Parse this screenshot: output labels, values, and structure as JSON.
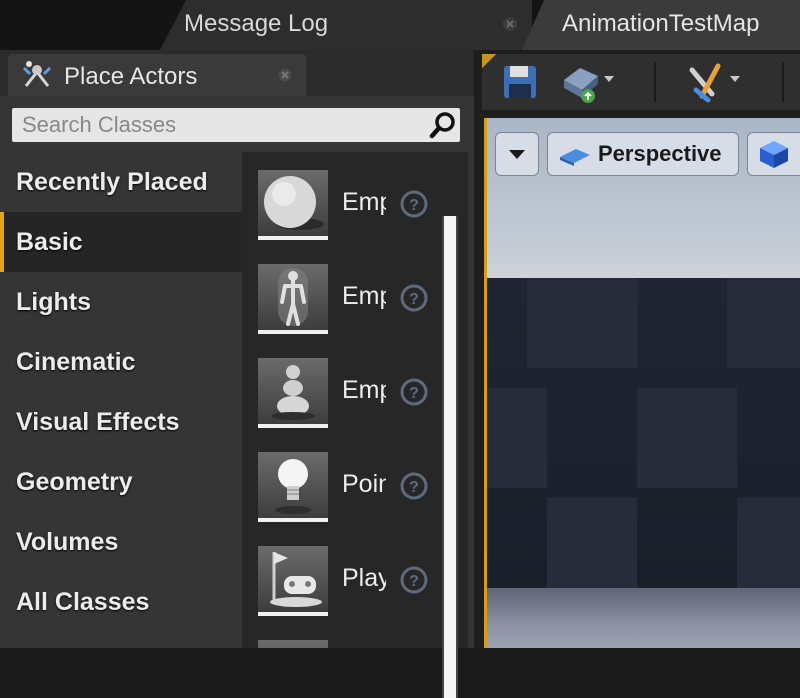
{
  "tabs": {
    "message_log": "Message Log",
    "map": "AnimationTestMap"
  },
  "place_actors": {
    "title": "Place Actors",
    "search_placeholder": "Search Classes",
    "categories": [
      {
        "label": "Recently Placed",
        "active": false
      },
      {
        "label": "Basic",
        "active": true
      },
      {
        "label": "Lights",
        "active": false
      },
      {
        "label": "Cinematic",
        "active": false
      },
      {
        "label": "Visual Effects",
        "active": false
      },
      {
        "label": "Geometry",
        "active": false
      },
      {
        "label": "Volumes",
        "active": false
      },
      {
        "label": "All Classes",
        "active": false
      }
    ],
    "items": [
      {
        "label": "Emp",
        "icon": "sphere-icon"
      },
      {
        "label": "Emp",
        "icon": "character-icon"
      },
      {
        "label": "Emp",
        "icon": "pawn-icon"
      },
      {
        "label": "Poin",
        "icon": "lightbulb-icon"
      },
      {
        "label": "Play",
        "icon": "player-start-icon"
      }
    ]
  },
  "viewport": {
    "view_mode": "Perspective"
  },
  "colors": {
    "accent": "#e3a31c",
    "panel": "#353535",
    "list_bg": "#272727"
  }
}
